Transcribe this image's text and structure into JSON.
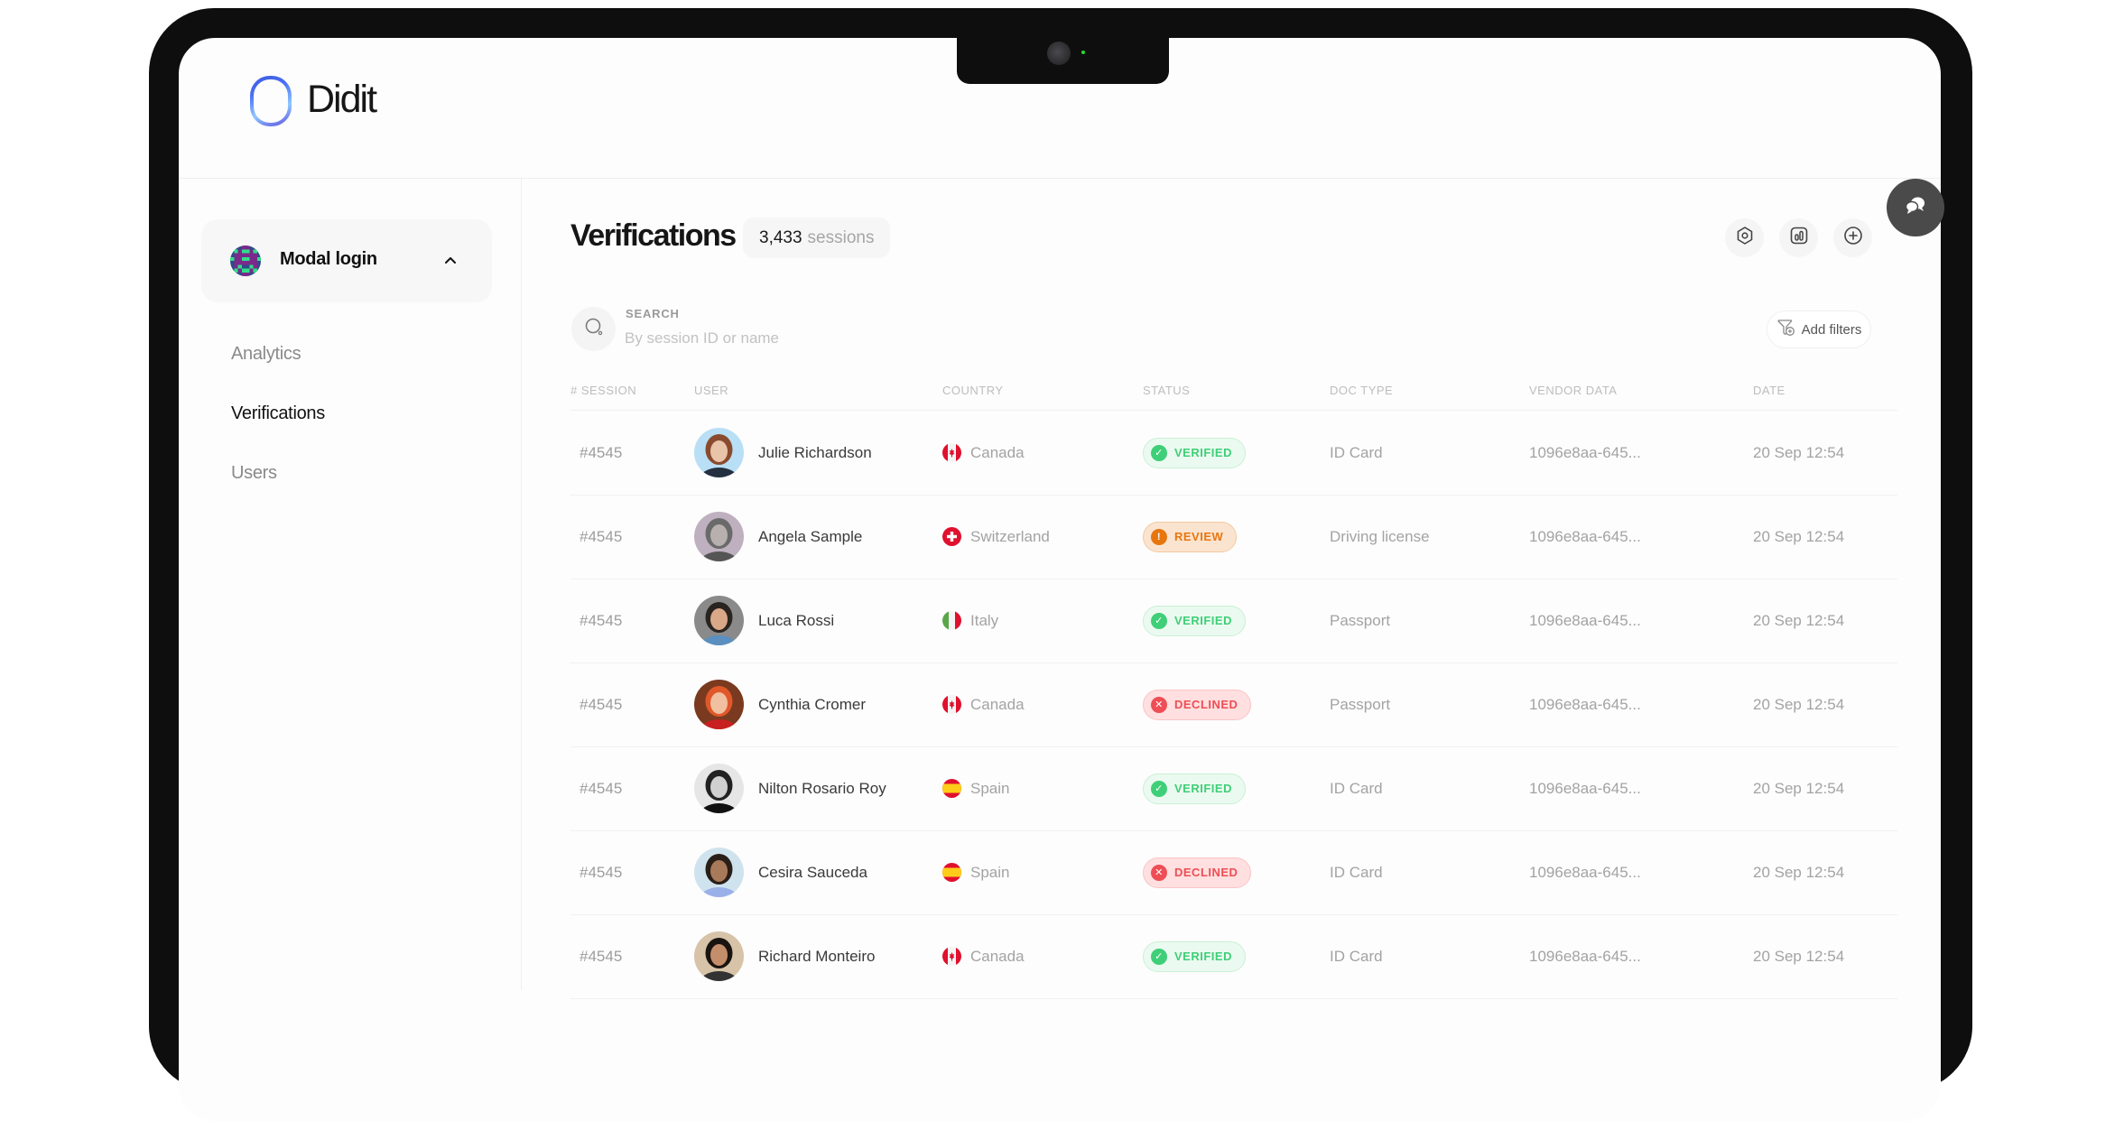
{
  "brand": {
    "name": "Didit"
  },
  "sidebar": {
    "project": {
      "name": "Modal login"
    },
    "items": [
      {
        "label": "Analytics",
        "active": false
      },
      {
        "label": "Verifications",
        "active": true
      },
      {
        "label": "Users",
        "active": false
      }
    ]
  },
  "header": {
    "title": "Verifications",
    "count": "3,433",
    "count_unit": "sessions",
    "actions": [
      {
        "icon": "settings-hexagon-icon"
      },
      {
        "icon": "analytics-chart-icon"
      },
      {
        "icon": "add-circle-icon"
      }
    ],
    "chat_icon": "chat-bubbles-icon"
  },
  "search": {
    "label": "SEARCH",
    "placeholder": "By session ID or name",
    "value": ""
  },
  "filters": {
    "label": "Add filters"
  },
  "table": {
    "columns": [
      "# Session",
      "User",
      "Country",
      "Status",
      "Doc type",
      "Vendor data",
      "Date"
    ],
    "rows": [
      {
        "session": "#4545",
        "user": "Julie Richardson",
        "country": "Canada",
        "flag": "ca",
        "status": "VERIFIED",
        "status_kind": "verified",
        "doc_type": "ID Card",
        "vendor_data": "1096e8aa-645...",
        "date": "20 Sep 12:54"
      },
      {
        "session": "#4545",
        "user": "Angela Sample",
        "country": "Switzerland",
        "flag": "ch",
        "status": "REVIEW",
        "status_kind": "review",
        "doc_type": "Driving license",
        "vendor_data": "1096e8aa-645...",
        "date": "20 Sep 12:54"
      },
      {
        "session": "#4545",
        "user": "Luca Rossi",
        "country": "Italy",
        "flag": "it",
        "status": "VERIFIED",
        "status_kind": "verified",
        "doc_type": "Passport",
        "vendor_data": "1096e8aa-645...",
        "date": "20 Sep 12:54"
      },
      {
        "session": "#4545",
        "user": "Cynthia Cromer",
        "country": "Canada",
        "flag": "ca",
        "status": "DECLINED",
        "status_kind": "declined",
        "doc_type": "Passport",
        "vendor_data": "1096e8aa-645...",
        "date": "20 Sep 12:54"
      },
      {
        "session": "#4545",
        "user": "Nilton Rosario Roy",
        "country": "Spain",
        "flag": "es",
        "status": "VERIFIED",
        "status_kind": "verified",
        "doc_type": "ID Card",
        "vendor_data": "1096e8aa-645...",
        "date": "20 Sep 12:54"
      },
      {
        "session": "#4545",
        "user": "Cesira Sauceda",
        "country": "Spain",
        "flag": "es",
        "status": "DECLINED",
        "status_kind": "declined",
        "doc_type": "ID Card",
        "vendor_data": "1096e8aa-645...",
        "date": "20 Sep 12:54"
      },
      {
        "session": "#4545",
        "user": "Richard Monteiro",
        "country": "Canada",
        "flag": "ca",
        "status": "VERIFIED",
        "status_kind": "verified",
        "doc_type": "ID Card",
        "vendor_data": "1096e8aa-645...",
        "date": "20 Sep 12:54"
      }
    ]
  },
  "colors": {
    "verified": "#3fcf78",
    "review": "#e8760f",
    "declined": "#ee4e55",
    "brand_gradient_start": "#3b5bdb",
    "brand_gradient_end": "#90c8ff"
  }
}
